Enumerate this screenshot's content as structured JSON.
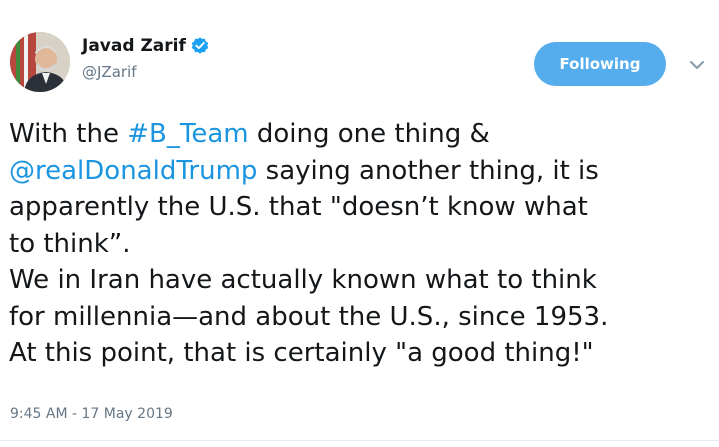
{
  "author": {
    "display_name": "Javad Zarif",
    "handle": "@JZarif",
    "verified": true
  },
  "follow_button": {
    "label": "Following"
  },
  "tweet": {
    "line1_prefix": "With the ",
    "hashtag": "#B_Team",
    "line1_suffix": " doing one thing &",
    "mention": "@realDonaldTrump",
    "line2_suffix": " saying another thing, it is",
    "line3": "apparently the U.S. that \"doesn’t know what",
    "line4": "to think”.",
    "line5": "We in Iran have actually known what to think",
    "line6": "for millennia—and about the U.S., since 1953.",
    "line7": "At this point, that is certainly \"a good thing!\""
  },
  "timestamp": "9:45 AM - 17 May 2019",
  "colors": {
    "link": "#1b95e0",
    "button": "#55adee",
    "secondary_text": "#657786"
  },
  "icons": {
    "verified": "verified-badge-icon",
    "caret": "chevron-down-icon"
  }
}
